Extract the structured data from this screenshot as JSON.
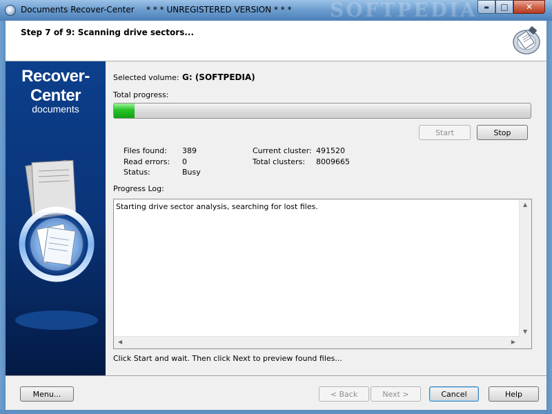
{
  "window": {
    "title": "Documents Recover-Center",
    "unregistered": "* * * UNREGISTERED VERSION * * *",
    "watermark": "SOFTPEDIA",
    "controls": {
      "minimize": "▬",
      "maximize": "□",
      "close": "✕"
    }
  },
  "header": {
    "step": "Step 7 of 9: Scanning drive sectors..."
  },
  "sidebar": {
    "brand_line1": "Recover-Center",
    "brand_line2": "documents"
  },
  "main": {
    "selected_volume_label": "Selected volume:",
    "selected_volume_value": "G: (SOFTPEDIA)",
    "total_progress_label": "Total progress:",
    "total_progress_percent": 5,
    "start_label": "Start",
    "stop_label": "Stop",
    "stats": {
      "files_found_label": "Files found:",
      "files_found_value": "389",
      "read_errors_label": "Read errors:",
      "read_errors_value": "0",
      "status_label": "Status:",
      "status_value": "Busy",
      "current_cluster_label": "Current cluster:",
      "current_cluster_value": "491520",
      "total_clusters_label": "Total clusters:",
      "total_clusters_value": "8009665"
    },
    "progress_log_label": "Progress Log:",
    "log_entries": [
      "Starting drive sector analysis, searching for lost files."
    ],
    "hint": "Click Start and wait. Then click Next to preview found files..."
  },
  "footer": {
    "menu_label": "Menu...",
    "back_label": "< Back",
    "next_label": "Next >",
    "cancel_label": "Cancel",
    "help_label": "Help"
  },
  "colors": {
    "sidebar_top": "#0c3f8c",
    "progress_green": "#27c229",
    "title_bar": "#6f9fd0"
  }
}
